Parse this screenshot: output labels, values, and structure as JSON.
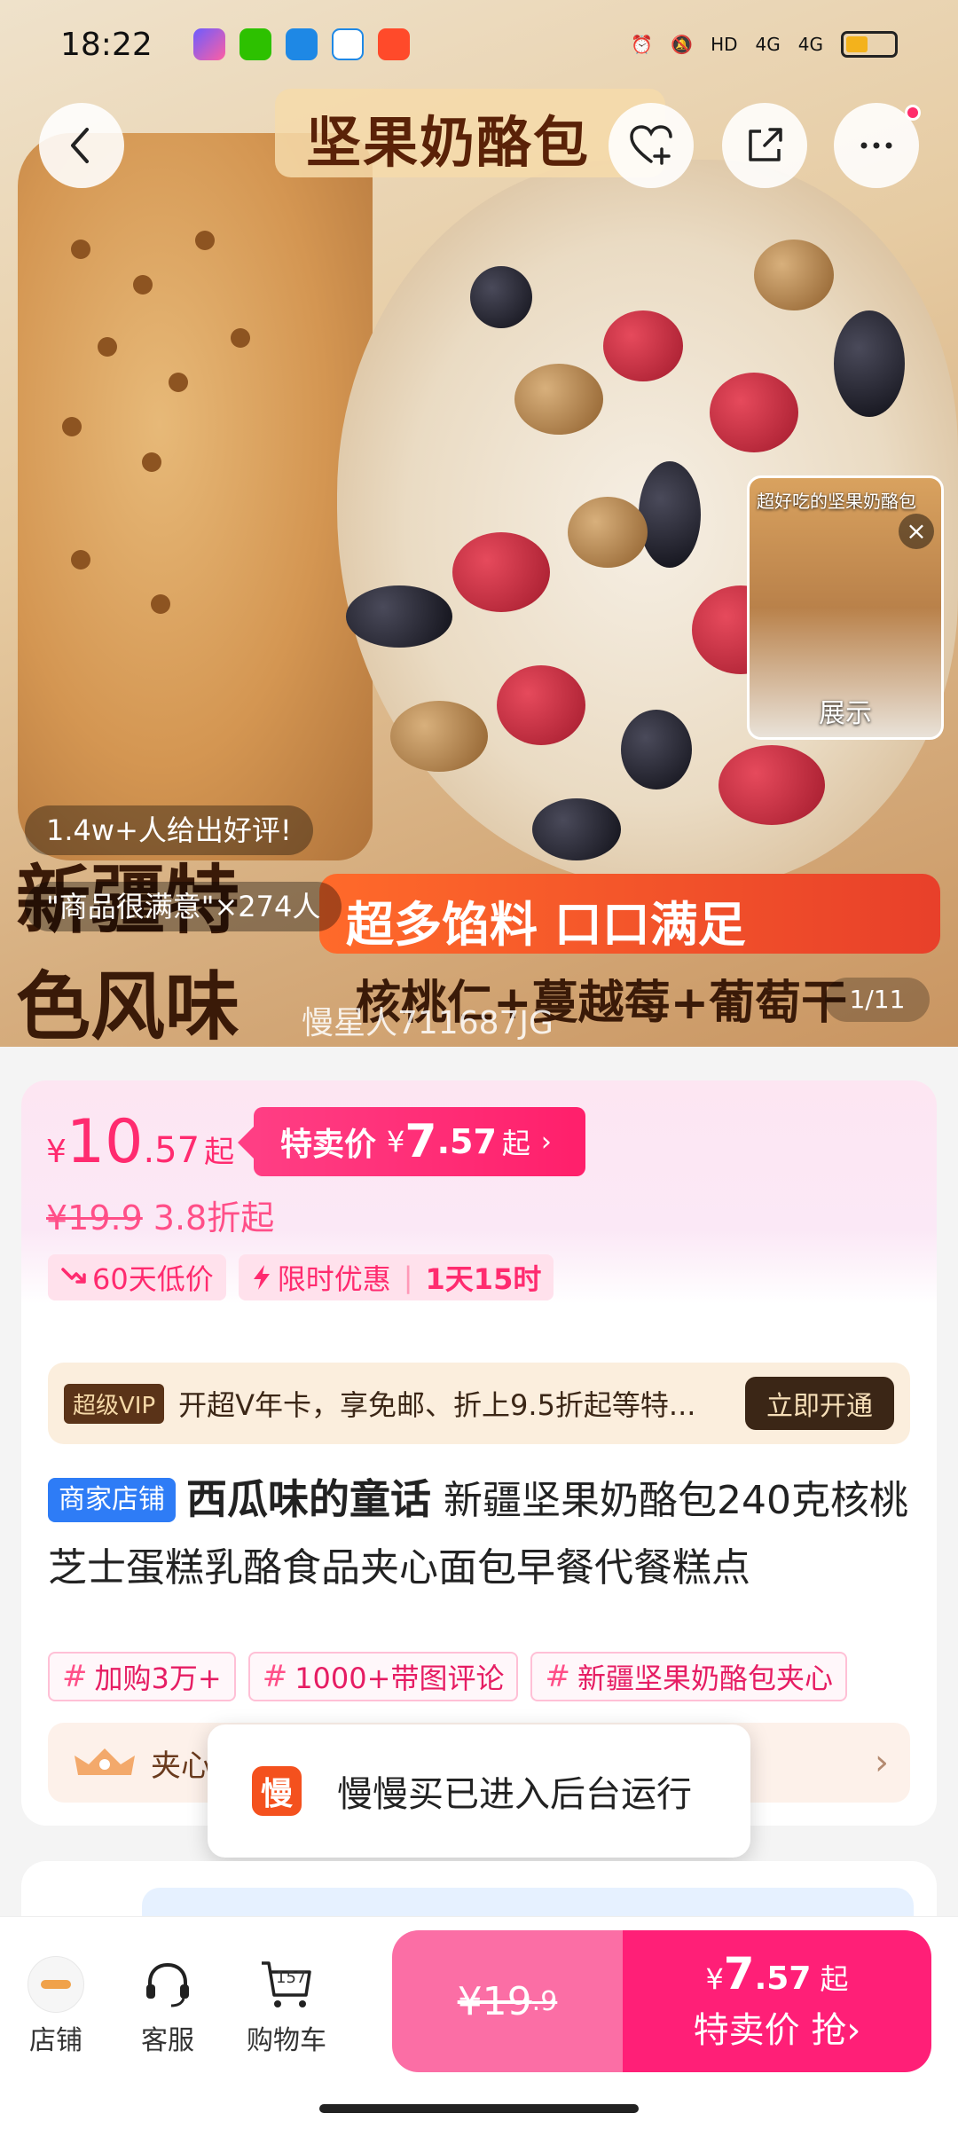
{
  "status_bar": {
    "time": "18:22",
    "network": "4G",
    "hd_label": "HD",
    "battery_level": 0.3
  },
  "hero": {
    "title": "坚果奶酪包",
    "review_line1": "1.4w+人给出好评!",
    "review_line2": "\"商品很满意\"×274人",
    "banner_red": "超多馅料 口口满足",
    "banner_left1": "新疆特",
    "banner_left2": "色风味",
    "banner_bottom": "核桃仁+蔓越莓+葡萄干",
    "watermark": "慢星人711687JG",
    "page_counter": "1/11",
    "mini_video_title": "超好吃的坚果奶酪包",
    "mini_video_label": "展示"
  },
  "price": {
    "yen": "¥",
    "main_int": "10",
    "main_dec": ".57",
    "qi": "起",
    "sale_label": "特卖价",
    "sale_int": "7",
    "sale_dec": ".57",
    "original": "¥19.9",
    "discount": "3.8折起"
  },
  "badges": {
    "low_price": "60天低价",
    "limited": "限时优惠",
    "countdown": "1天15时"
  },
  "vip": {
    "tag": "超级VIP",
    "text": "开超V年卡，享免邮、折上9.5折起等特...",
    "button": "立即开通"
  },
  "product": {
    "shop_tag": "商家店铺",
    "shop_name": "西瓜味的童话",
    "title": " 新疆坚果奶酪包240克核桃芝士蛋糕乳酪食品夹心面包早餐代餐糕点"
  },
  "tags": [
    "加购3万+",
    "1000+带图评论",
    "新疆坚果奶酪包夹心"
  ],
  "rank": {
    "text": "夹心"
  },
  "toast": {
    "icon_char": "慢",
    "text": "慢慢买已进入后台运行"
  },
  "bottom_bar": {
    "store": "店铺",
    "service": "客服",
    "cart": "购物车",
    "cart_count": "157",
    "buy_left_int": "¥19",
    "buy_left_dec": ".9",
    "buy_right_yen": "¥",
    "buy_right_int": "7",
    "buy_right_dec": ".57",
    "buy_right_qi": "起",
    "buy_right_action": "特卖价 抢"
  },
  "colors": {
    "accent": "#ff1f77",
    "vip_brown": "#3b2616",
    "shop_tag_blue": "#2e7cf6"
  },
  "icons": [
    "back-arrow-icon",
    "favorite-add-icon",
    "share-icon",
    "more-icon",
    "close-icon",
    "trend-down-icon",
    "lightning-icon",
    "chevron-right-icon",
    "headset-icon",
    "cart-icon"
  ]
}
